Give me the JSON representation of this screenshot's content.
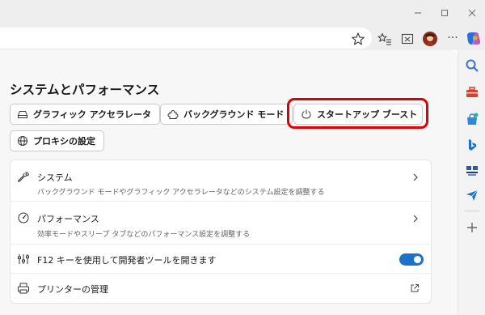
{
  "window": {
    "minimize_icon": "minimize-icon",
    "maximize_icon": "maximize-icon",
    "close_icon": "close-icon"
  },
  "toolbar": {
    "icons": [
      "favorite-star-icon",
      "favorites-list-icon",
      "screenshot-icon",
      "profile-avatar-icon",
      "more-options-icon",
      "copilot-icon"
    ],
    "more_label": "···"
  },
  "sidebar_rail": {
    "icons": [
      "search-icon",
      "toolbox-icon",
      "shopping-icon",
      "bing-icon",
      "translate-app-icon",
      "send-icon",
      "add-icon"
    ]
  },
  "settings": {
    "title": "システムとパフォーマンス",
    "quick_links": [
      {
        "label": "グラフィック アクセラレータ",
        "icon": "drive-icon"
      },
      {
        "label": "バックグラウンド モード",
        "icon": "puzzle-icon"
      },
      {
        "label": "スタートアップ ブースト",
        "icon": "power-icon",
        "highlighted": true
      },
      {
        "label": "プロキシの設定",
        "icon": "globe-icon"
      }
    ],
    "items": [
      {
        "title": "システム",
        "description": "バックグラウンド モードやグラフィック アクセラレータなどのシステム設定を調整する",
        "icon": "wrench-icon",
        "action": "chevron"
      },
      {
        "title": "パフォーマンス",
        "description": "効率モードやスリープ タブなどのパフォーマンス設定を調整する",
        "icon": "gauge-icon",
        "action": "chevron"
      },
      {
        "title": "F12 キーを使用して開発者ツールを開きます",
        "icon": "devtools-icon",
        "action": "toggle",
        "toggle_on": true
      },
      {
        "title": "プリンターの管理",
        "icon": "printer-icon",
        "action": "external-link"
      }
    ]
  },
  "colors": {
    "accent": "#1a73c8",
    "highlight": "#e00000"
  }
}
